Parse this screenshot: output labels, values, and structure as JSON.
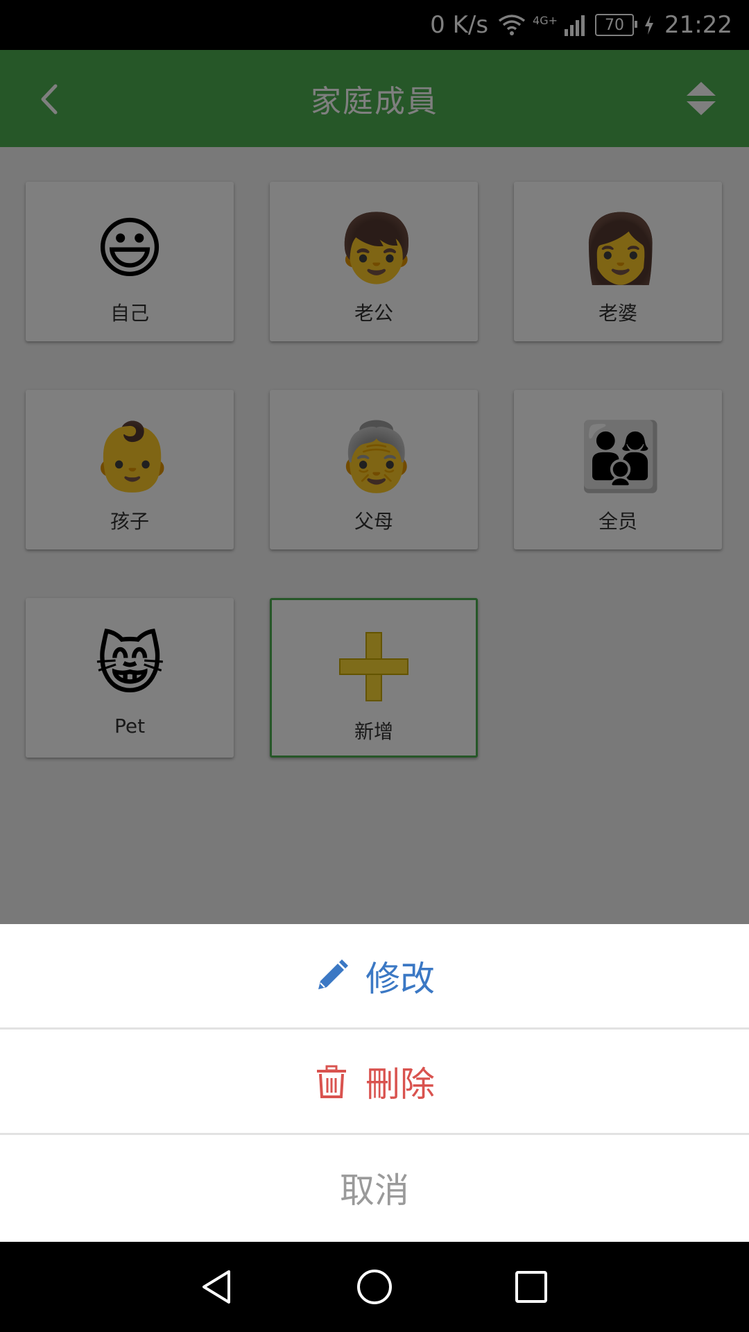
{
  "status_bar": {
    "net_speed": "0 K/s",
    "network": "4G+",
    "battery": "70",
    "time": "21:22"
  },
  "app_bar": {
    "title": "家庭成員",
    "back_icon": "chevron-left-icon",
    "sort_icon": "sort-updown-icon"
  },
  "members": [
    {
      "label": "自己",
      "emoji": "😃"
    },
    {
      "label": "老公",
      "emoji": "👦"
    },
    {
      "label": "老婆",
      "emoji": "👩"
    },
    {
      "label": "孩子",
      "emoji": "👶"
    },
    {
      "label": "父母",
      "emoji": "👵"
    },
    {
      "label": "全员",
      "emoji": "👨‍👩‍👦"
    },
    {
      "label": "Pet",
      "emoji": "😸"
    }
  ],
  "add_card": {
    "label": "新增",
    "icon": "plus-icon"
  },
  "sheet": {
    "edit_label": "修改",
    "delete_label": "刪除",
    "cancel_label": "取消"
  },
  "colors": {
    "primary": "#4CAF50",
    "edit": "#3B78C4",
    "delete": "#D9534F",
    "cancel": "#9a9a9a"
  }
}
